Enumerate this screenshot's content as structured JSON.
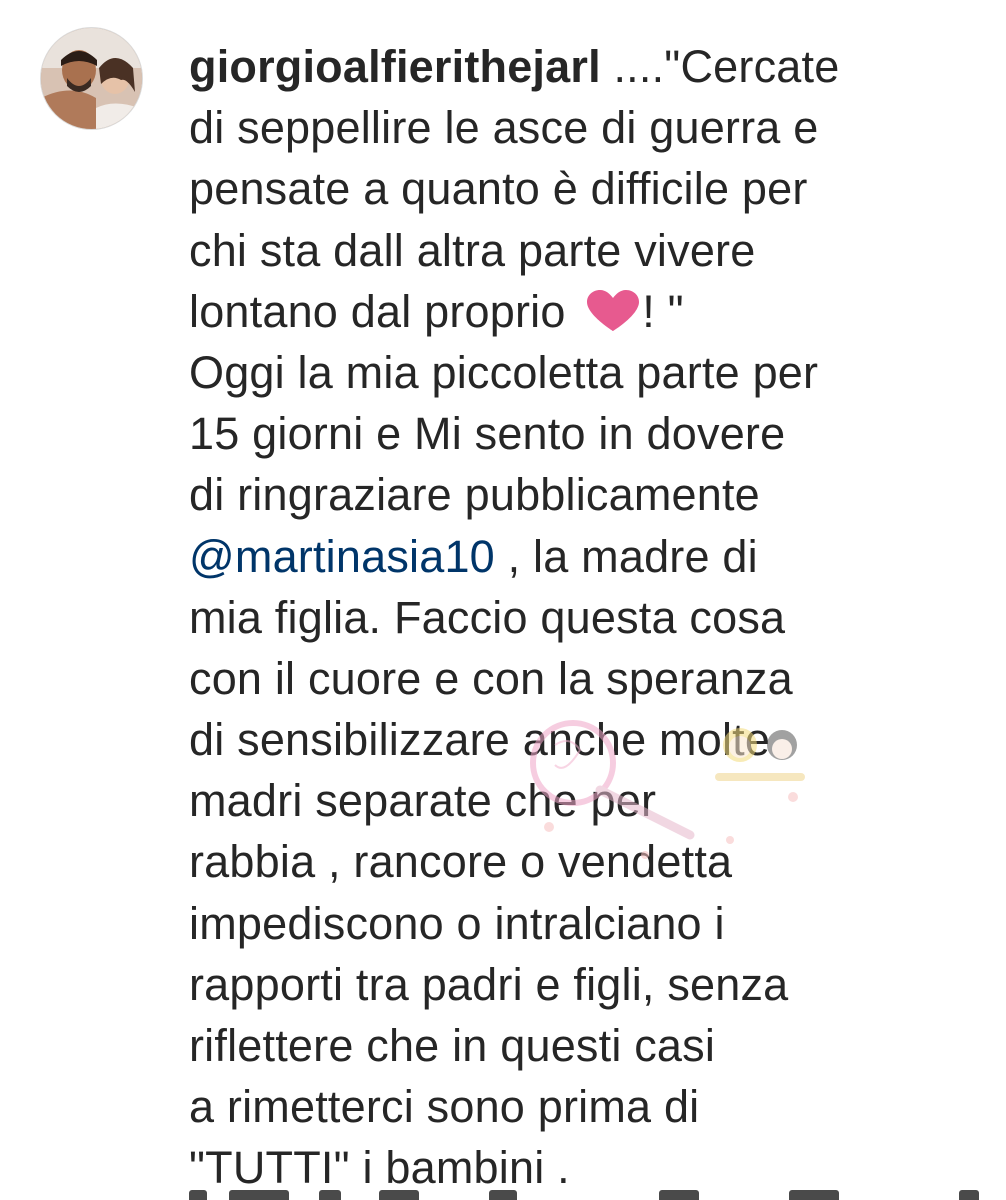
{
  "post": {
    "username": "giorgioalfierithejarl",
    "avatar_icon": "profile-photo",
    "heart_color": "#e75a8f",
    "mention_color": "#003569",
    "lines": {
      "l1": " ....\"Cercate",
      "l2": "di seppellire le asce di guerra e",
      "l3": "pensate a quanto è difficile per",
      "l4": "chi sta dall altra parte vivere",
      "l5_before": "lontano dal proprio ",
      "l5_after": "! \"",
      "l6": "Oggi  la mia piccoletta parte per",
      "l7": "15 giorni e Mi sento in dovere",
      "l8": "di ringraziare pubblicamente",
      "l9_mention": "@martinasia10",
      "l9_after": " , la madre di",
      "l10": "mia figlia. Faccio questa cosa",
      "l11": "con il cuore e  con la speranza",
      "l12": "di sensibilizzare anche  molte",
      "l13": "madri separate che per",
      "l14": "rabbia , rancore o vendetta",
      "l15": "impediscono o intralciano  i",
      "l16": "rapporti  tra padri e figli,  senza",
      "l17": "riflettere che in questi casi",
      "l18": "a rimetterci sono prima di",
      "l19": "\"TUTTI\" i bambini ."
    }
  }
}
